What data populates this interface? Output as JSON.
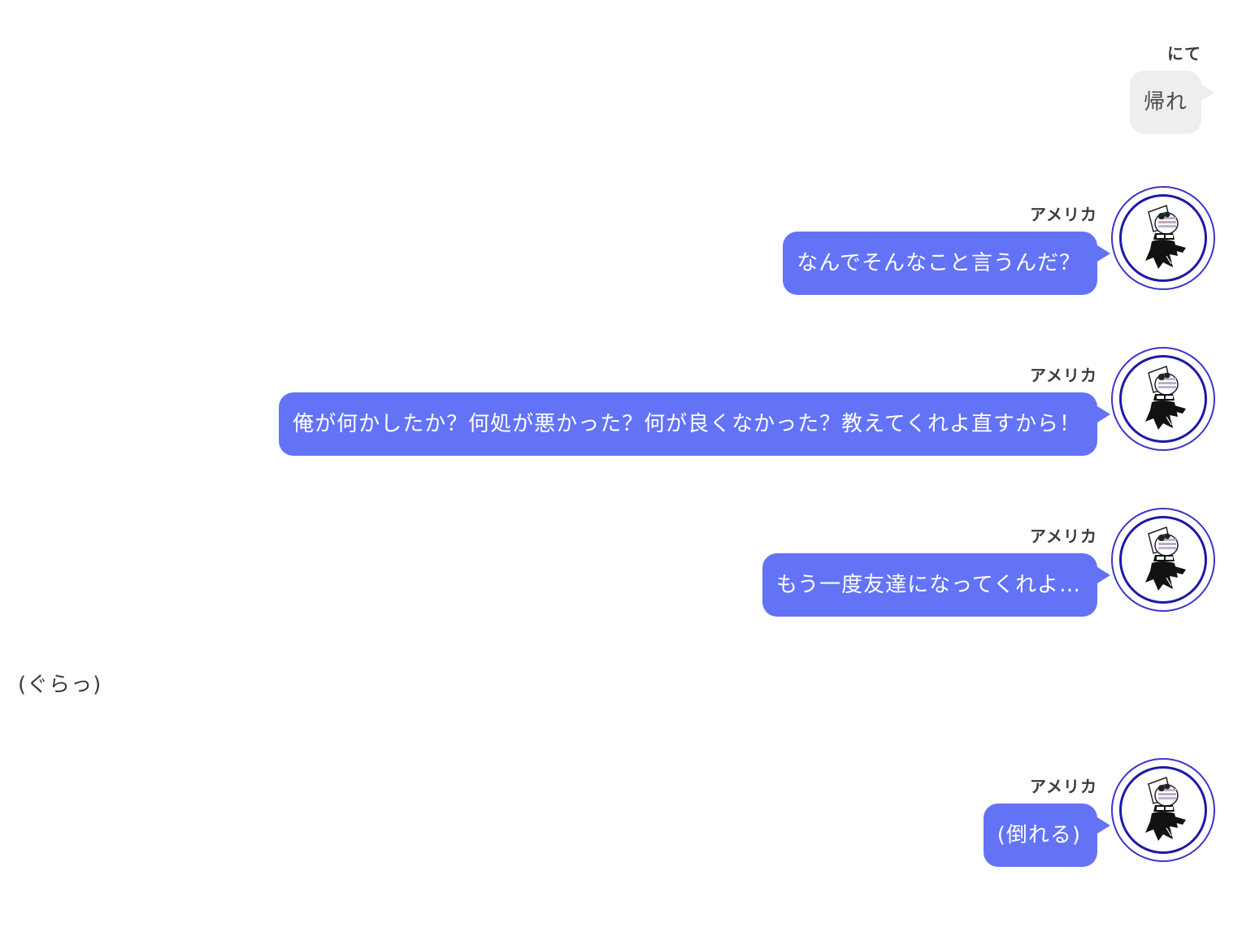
{
  "messages": [
    {
      "speaker": "にて",
      "text": "帰れ"
    },
    {
      "speaker": "アメリカ",
      "text": "なんでそんなこと言うんだ？"
    },
    {
      "speaker": "アメリカ",
      "text": "俺が何かしたか？何処が悪かった？何が良くなかった？教えてくれよ直すから！"
    },
    {
      "speaker": "アメリカ",
      "text": "もう一度友達になってくれよ…"
    },
    {
      "narration": "(ぐらっ)"
    },
    {
      "speaker": "アメリカ",
      "text": "(倒れる)"
    }
  ],
  "colors": {
    "blue_bubble": "#6373f5",
    "gray_bubble": "#eeeeee",
    "avatar_ring": "#1c1aa6"
  },
  "icons": {
    "avatar": "character-avatar-icon"
  }
}
